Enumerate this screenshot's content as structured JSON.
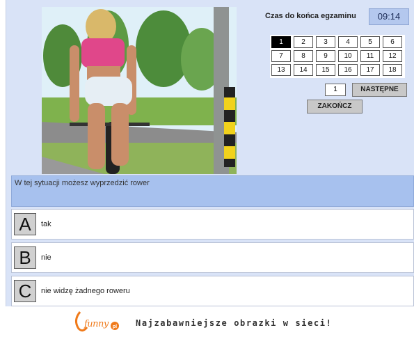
{
  "timer": {
    "label": "Czas do końca egzaminu",
    "value": "09:14"
  },
  "question_nav": {
    "numbers": [
      "1",
      "2",
      "3",
      "4",
      "5",
      "6",
      "7",
      "8",
      "9",
      "10",
      "11",
      "12",
      "13",
      "14",
      "15",
      "16",
      "17",
      "18"
    ],
    "active": "1",
    "goto_value": "1",
    "next_label": "NASTĘPNE",
    "finish_label": "ZAKOŃCZ"
  },
  "question": {
    "text": "W tej sytuacji możesz wyprzedzić rower"
  },
  "answers": [
    {
      "letter": "A",
      "text": "tak"
    },
    {
      "letter": "B",
      "text": "nie"
    },
    {
      "letter": "C",
      "text": "nie widzę żadnego roweru"
    }
  ],
  "footer": {
    "logo_text": "funny",
    "logo_badge": "pl",
    "slogan": "Najzabawniejsze obrazki w sieci!"
  },
  "colors": {
    "panel": "#d9e3f7",
    "question_bg": "#a7c1ee",
    "timer_bg": "#b4c8ee",
    "logo_orange": "#f07a1a"
  }
}
